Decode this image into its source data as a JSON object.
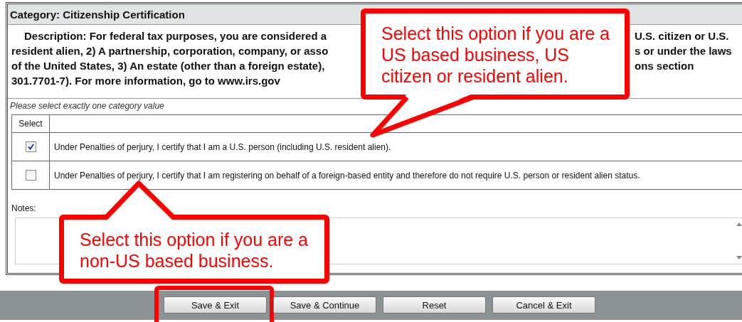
{
  "header": {
    "title": "Category: Citizenship Certification"
  },
  "description": {
    "lines": [
      {
        "left": "Description: For federal tax purposes, you are considered a",
        "right": "U.S. citizen or U.S."
      },
      {
        "left": "resident alien, 2) A partnership, corporation, company, or asso",
        "right": "s or under the laws"
      },
      {
        "left": "of the United States, 3) An estate (other than a foreign estate),",
        "right": "ons section"
      },
      {
        "left": "301.7701-7). For more information, go to www.irs.gov"
      }
    ]
  },
  "instruction": "Please select exactly one category value",
  "table": {
    "columns": [
      "Select"
    ],
    "rows": [
      {
        "checked": true,
        "text": "Under Penalties of perjury, I certify that I am a U.S. person (including U.S. resident alien)."
      },
      {
        "checked": false,
        "text": "Under Penalties of perjury, I certify that I am registering on behalf of a foreign-based entity and therefore do not require U.S. person or resident alien status."
      }
    ]
  },
  "notes": {
    "label": "Notes:"
  },
  "buttons": [
    {
      "label": "Save & Exit",
      "highlighted": true
    },
    {
      "label": "Save & Continue",
      "highlighted": false
    },
    {
      "label": "Reset",
      "highlighted": false
    },
    {
      "label": "Cancel & Exit",
      "highlighted": false
    }
  ],
  "callouts": [
    {
      "text": "Select this option if you are a US based business, US citizen or resident alien."
    },
    {
      "text": "Select this option if you are a non-US based business."
    }
  ]
}
